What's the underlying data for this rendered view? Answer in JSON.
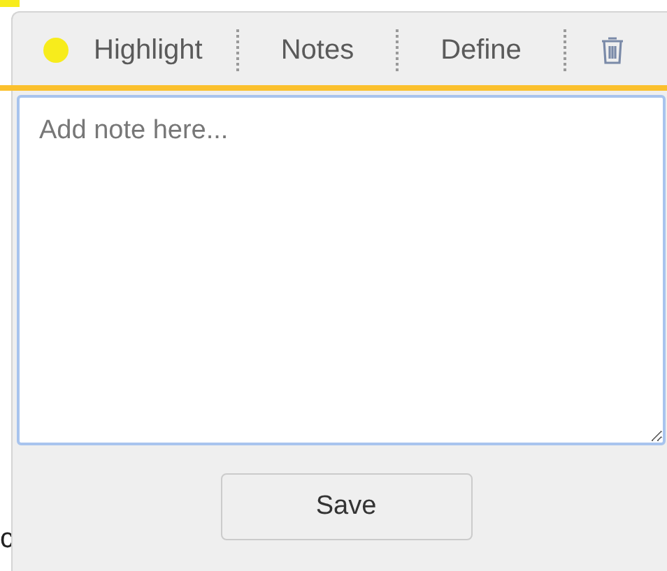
{
  "background": {
    "edge_text": "c"
  },
  "toolbar": {
    "items": [
      {
        "kind": "highlight",
        "label": "Highlight"
      },
      {
        "kind": "text",
        "label": "Notes"
      },
      {
        "kind": "text",
        "label": "Define"
      },
      {
        "kind": "delete"
      }
    ]
  },
  "note": {
    "placeholder": "Add note here..."
  },
  "save_button": "Save"
}
